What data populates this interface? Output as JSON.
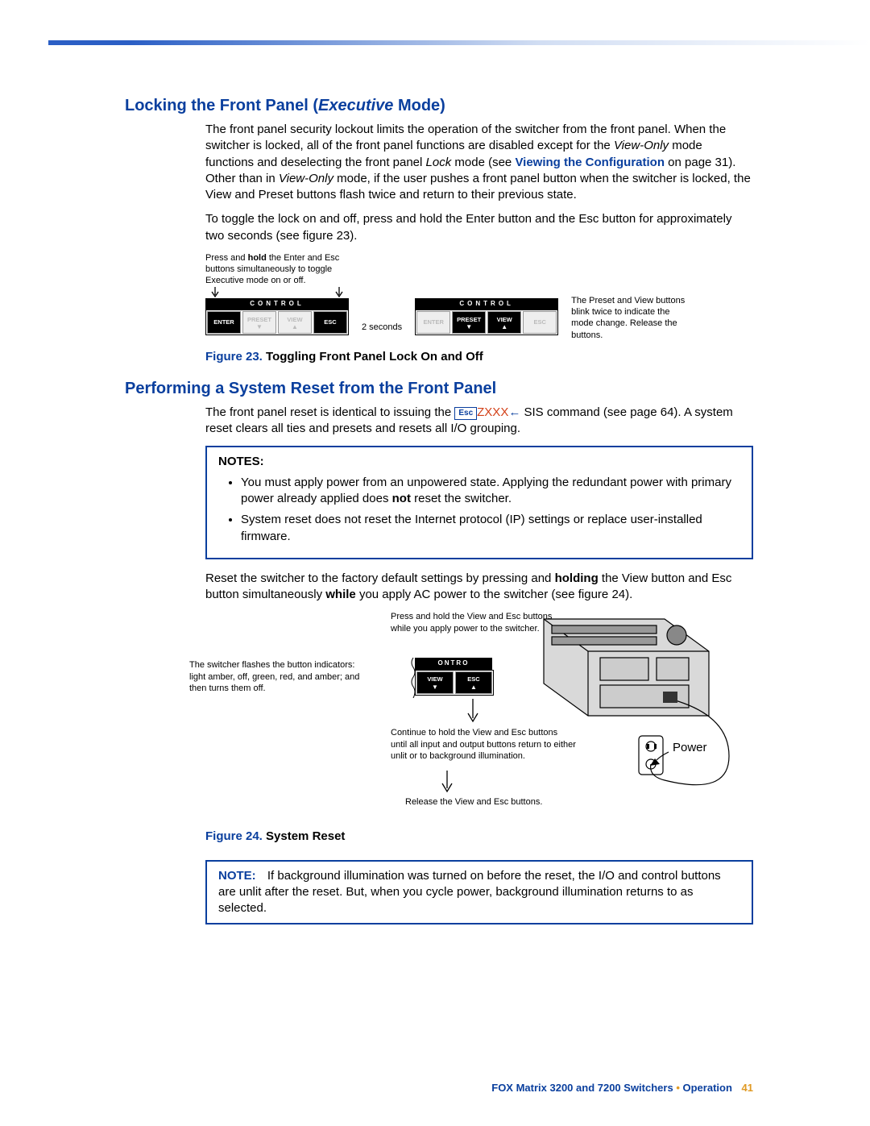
{
  "section1": {
    "title_plain": "Locking the Front Panel (",
    "title_italic": "Executive",
    "title_tail": " Mode)",
    "p1a": "The front panel security lockout limits the operation of the switcher from the front panel. When the switcher is locked, all of the front panel functions are disabled except for the ",
    "p1b_i": "View-Only",
    "p1c": " mode functions and deselecting the front panel ",
    "p1d_i": "Lock",
    "p1e": " mode (see ",
    "p1_link": "Viewing the Configuration",
    "p1f": " on page 31). Other than in ",
    "p1g_i": "View-Only",
    "p1h": " mode, if the user pushes a front panel button when the switcher is locked, the View and Preset buttons flash twice and return to their previous state.",
    "p2": "To toggle the lock on and off, press and hold the Enter button and the Esc button for approximately two seconds (see figure 23)."
  },
  "fig23": {
    "left_a": "Press and ",
    "left_b": "hold",
    "left_c": " the Enter and Esc buttons simultaneously to toggle Executive mode on or off.",
    "control_label": "CONTROL",
    "btn_enter": "ENTER",
    "btn_preset": "PRESET",
    "btn_view": "VIEW",
    "btn_esc": "ESC",
    "mid": "2 seconds",
    "right": "The Preset and View buttons blink twice to indicate the mode change.\nRelease the buttons.",
    "caption_num": "Figure 23.",
    "caption_title": "Toggling Front Panel Lock On and Off"
  },
  "section2": {
    "title": "Performing a System Reset from the Front Panel",
    "p1a": "The front panel reset is identical to issuing the ",
    "sis_esc": "Esc",
    "sis_cmd": "ZXXX",
    "sis_arrow": "←",
    "p1b": " SIS command (see page 64). A system reset clears all ties and presets and resets all I/O grouping.",
    "notes_title": "NOTES:",
    "note1a": "You must apply power from an unpowered state. Applying the redundant power with primary power already applied does ",
    "note1b": "not",
    "note1c": " reset the switcher.",
    "note2": "System reset does not reset the Internet protocol (IP) settings or replace user-installed firmware.",
    "p2a": "Reset the switcher to the factory default settings by pressing and ",
    "p2b": "holding",
    "p2c": " the View button and Esc button simultaneously ",
    "p2d": "while",
    "p2e": " you apply AC power to the switcher (see figure 24)."
  },
  "fig24": {
    "note_left": "The switcher flashes the button indicators: light amber, off, green, red, and amber; and then turns them off.",
    "note_top": "Press and hold the View and Esc buttons while you apply power to the switcher.",
    "note_mid": "Continue to hold the View and Esc buttons until all input and output buttons return to either unlit or to background illumination.",
    "note_bot": "Release the View and Esc buttons.",
    "ctrl": "ONTRO",
    "btn_view": "VIEW",
    "btn_esc": "ESC",
    "power": "Power",
    "caption_num": "Figure 24.",
    "caption_title": "System Reset"
  },
  "note_final": {
    "title": "NOTE:",
    "body": "If background illumination was turned on before the reset, the I/O and control buttons are unlit after the reset. But, when you cycle power, background illumination returns to as selected."
  },
  "footer": {
    "text": "FOX Matrix 3200 and 7200 Switchers",
    "dot": "•",
    "section": "Operation",
    "page": "41"
  }
}
